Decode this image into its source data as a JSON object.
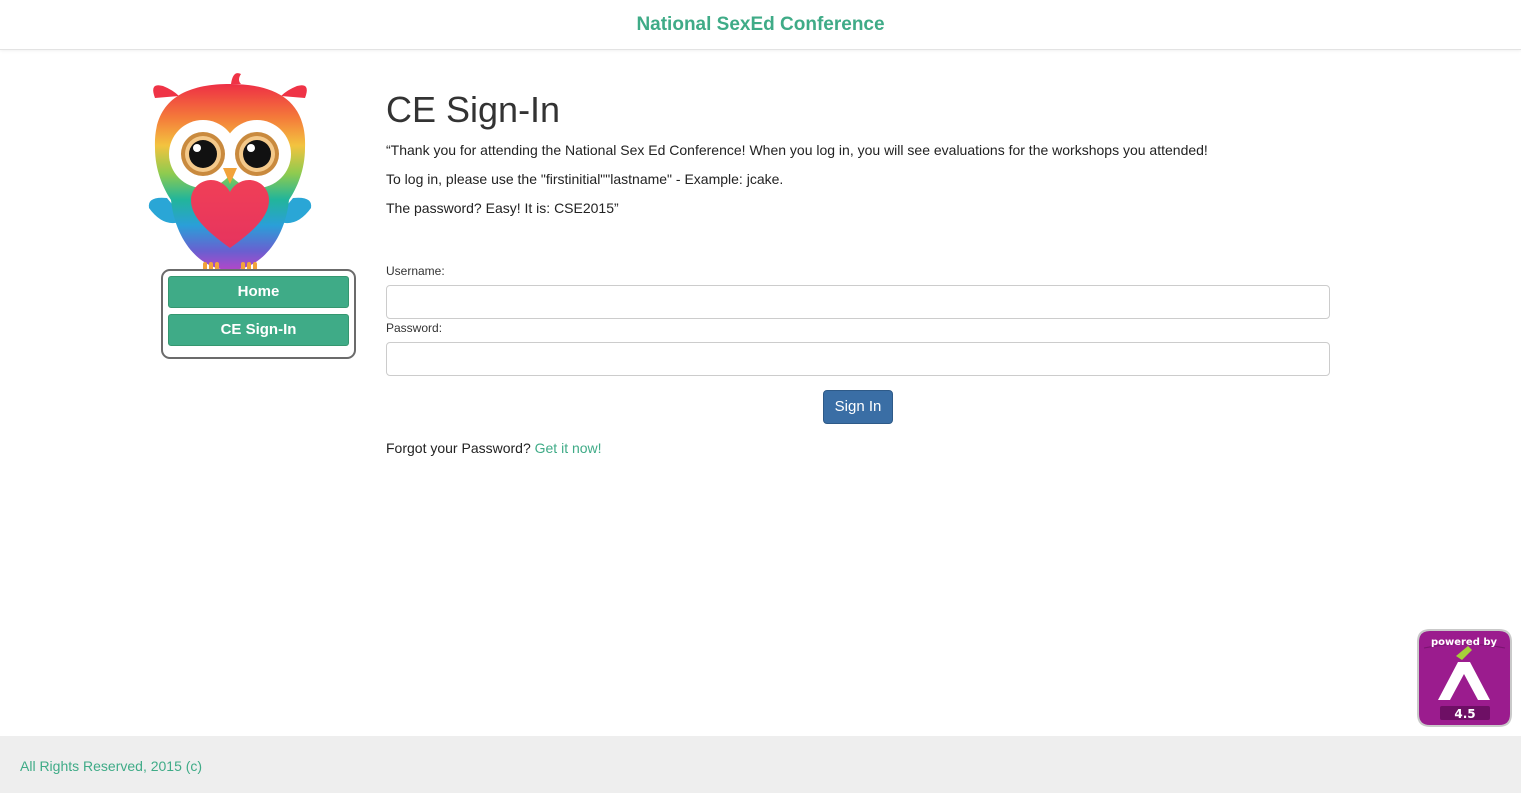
{
  "header": {
    "title": "National SexEd Conference"
  },
  "sidebar": {
    "logo": "owl-logo-icon",
    "nav": [
      {
        "label": "Home"
      },
      {
        "label": "CE Sign-In"
      }
    ]
  },
  "main": {
    "title": "CE Sign-In",
    "intro": [
      "“Thank you for attending the National Sex Ed Conference! When you log in, you will see evaluations for the workshops you attended!",
      "To log in, please use the \"firstinitial\"\"lastname\" - Example: jcake.",
      "The password? Easy! It is: CSE2015”"
    ],
    "form": {
      "username_label": "Username:",
      "username_value": "",
      "password_label": "Password:",
      "password_value": "",
      "submit_label": "Sign In"
    },
    "forgot": {
      "text": "Forgot your Password? ",
      "link": "Get it now!"
    }
  },
  "badge": {
    "top_text": "powered by",
    "version": "4.5",
    "icon": "powered-by-badge-icon"
  },
  "footer": {
    "text": "All Rights Reserved, 2015 (c)"
  },
  "colors": {
    "accent": "#3fab87",
    "primary_button": "#3a6ea5",
    "footer_bg": "#eeeeee",
    "badge": "#9b1c8e"
  }
}
